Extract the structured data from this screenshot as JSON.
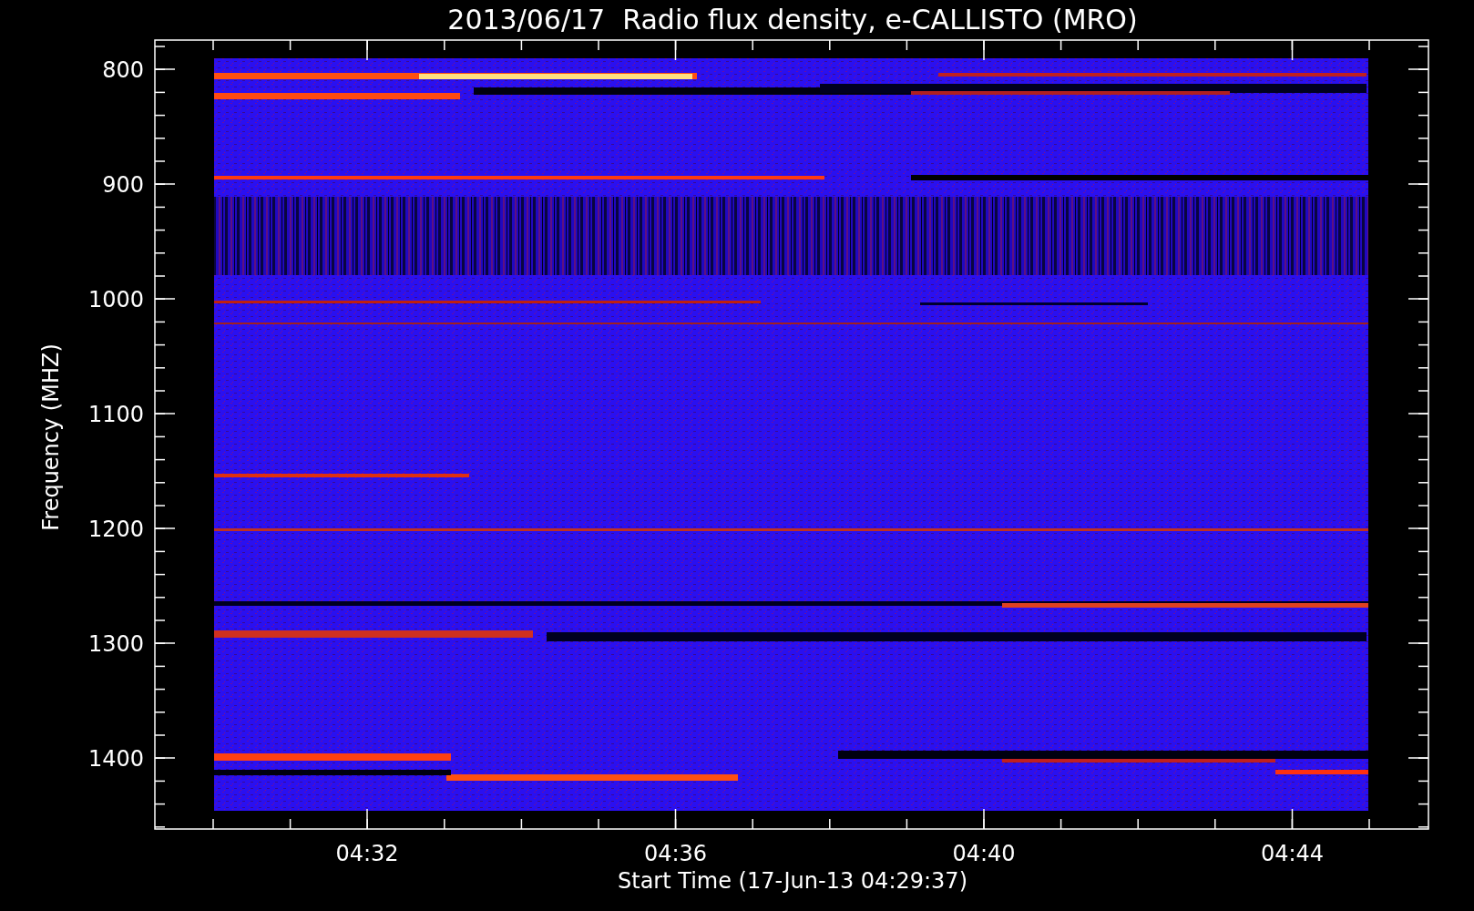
{
  "title": "2013/06/17  Radio flux density, e-CALLISTO (MRO)",
  "y_axis": {
    "label": "Frequency (MHZ)",
    "ticks": [
      "800",
      "900",
      "1000",
      "1100",
      "1200",
      "1300",
      "1400"
    ]
  },
  "x_axis": {
    "label": "Start Time (17-Jun-13 04:29:37)",
    "ticks": [
      "04:32",
      "04:36",
      "04:40",
      "04:44"
    ]
  }
}
